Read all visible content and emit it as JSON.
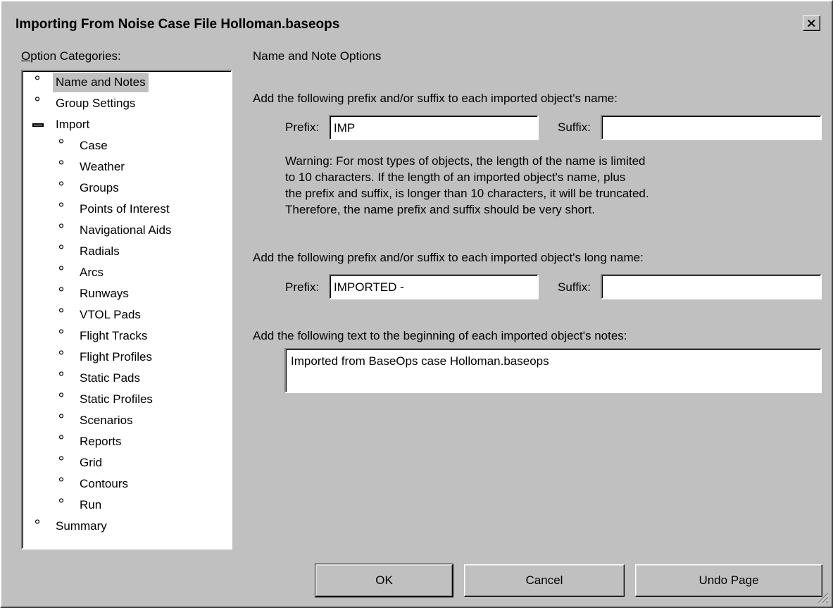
{
  "window": {
    "title": "Importing From Noise Case File Holloman.baseops"
  },
  "sidebar": {
    "label_accel": "O",
    "label_rest": "ption Categories:",
    "items": [
      {
        "label": "Name and Notes",
        "level": 0,
        "marker": "bullet",
        "selected": true
      },
      {
        "label": "Group Settings",
        "level": 0,
        "marker": "bullet"
      },
      {
        "label": "Import",
        "level": 0,
        "marker": "minus"
      },
      {
        "label": "Case",
        "level": 1,
        "marker": "bullet"
      },
      {
        "label": "Weather",
        "level": 1,
        "marker": "bullet"
      },
      {
        "label": "Groups",
        "level": 1,
        "marker": "bullet"
      },
      {
        "label": "Points of Interest",
        "level": 1,
        "marker": "bullet"
      },
      {
        "label": "Navigational Aids",
        "level": 1,
        "marker": "bullet"
      },
      {
        "label": "Radials",
        "level": 1,
        "marker": "bullet"
      },
      {
        "label": "Arcs",
        "level": 1,
        "marker": "bullet"
      },
      {
        "label": "Runways",
        "level": 1,
        "marker": "bullet"
      },
      {
        "label": "VTOL Pads",
        "level": 1,
        "marker": "bullet"
      },
      {
        "label": "Flight Tracks",
        "level": 1,
        "marker": "bullet"
      },
      {
        "label": "Flight Profiles",
        "level": 1,
        "marker": "bullet"
      },
      {
        "label": "Static Pads",
        "level": 1,
        "marker": "bullet"
      },
      {
        "label": "Static Profiles",
        "level": 1,
        "marker": "bullet"
      },
      {
        "label": "Scenarios",
        "level": 1,
        "marker": "bullet"
      },
      {
        "label": "Reports",
        "level": 1,
        "marker": "bullet"
      },
      {
        "label": "Grid",
        "level": 1,
        "marker": "bullet"
      },
      {
        "label": "Contours",
        "level": 1,
        "marker": "bullet"
      },
      {
        "label": "Run",
        "level": 1,
        "marker": "bullet"
      },
      {
        "label": "Summary",
        "level": 0,
        "marker": "bullet"
      }
    ]
  },
  "main": {
    "heading": "Name and Note Options",
    "name_section": {
      "instruction": "Add the following prefix and/or suffix to each imported object's name:",
      "prefix_label": "Prefix:",
      "prefix_value": "IMP",
      "suffix_label": "Suffix:",
      "suffix_value": ""
    },
    "warning": [
      "Warning: For most types of objects, the length of the name is limited",
      "to 10 characters.  If the length of an imported object's name, plus",
      "the prefix and suffix, is longer than 10 characters, it will be truncated.",
      "Therefore, the name prefix and suffix should be very short."
    ],
    "long_name_section": {
      "instruction": "Add the following prefix and/or suffix to each imported object's long name:",
      "prefix_label": "Prefix:",
      "prefix_value": "IMPORTED -",
      "suffix_label": "Suffix:",
      "suffix_value": ""
    },
    "notes_section": {
      "instruction": "Add the following text to the beginning of each imported object's notes:",
      "notes_value": "Imported from BaseOps case Holloman.baseops"
    }
  },
  "footer": {
    "ok_label": "OK",
    "cancel_label": "Cancel",
    "undo_label": "Undo Page"
  }
}
